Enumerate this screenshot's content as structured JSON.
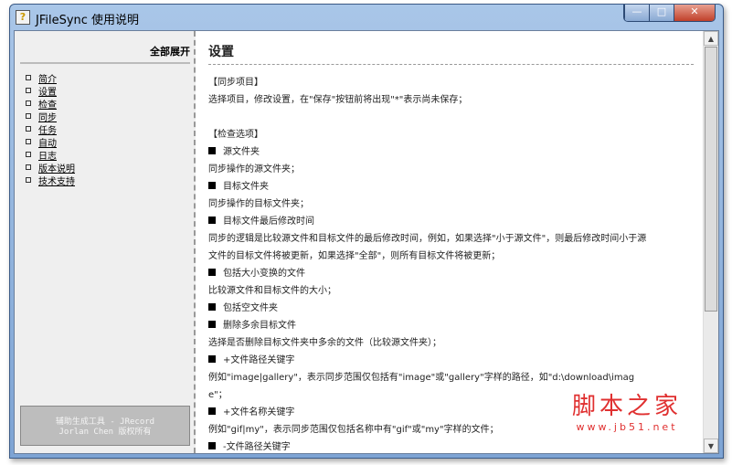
{
  "window": {
    "title": "JFileSync 使用说明",
    "min": "—",
    "max": "□",
    "close": "✕"
  },
  "sidebar": {
    "expand_all": "全部展开",
    "items": [
      "简介",
      "设置",
      "检查",
      "同步",
      "任务",
      "自动",
      "日志",
      "版本说明",
      "技术支持"
    ],
    "footer_line1": "辅助生成工具 - JRecord",
    "footer_line2": "Jorlan Chen 版权所有"
  },
  "content": {
    "title": "设置",
    "lines": [
      {
        "bullet": false,
        "text": "【同步项目】"
      },
      {
        "bullet": false,
        "text": "选择项目，修改设置，在\"保存\"按钮前将出现\"*\"表示尚未保存；"
      },
      {
        "bullet": false,
        "text": ""
      },
      {
        "bullet": false,
        "text": "【检查选项】"
      },
      {
        "bullet": true,
        "text": "源文件夹"
      },
      {
        "bullet": false,
        "text": "同步操作的源文件夹；"
      },
      {
        "bullet": true,
        "text": "目标文件夹"
      },
      {
        "bullet": false,
        "text": "同步操作的目标文件夹；"
      },
      {
        "bullet": true,
        "text": "目标文件最后修改时间"
      },
      {
        "bullet": false,
        "text": "同步的逻辑是比较源文件和目标文件的最后修改时间，例如，如果选择\"小于源文件\"，则最后修改时间小于源"
      },
      {
        "bullet": false,
        "text": "文件的目标文件将被更新，如果选择\"全部\"，则所有目标文件将被更新；"
      },
      {
        "bullet": true,
        "text": "包括大小变换的文件"
      },
      {
        "bullet": false,
        "text": "比较源文件和目标文件的大小；"
      },
      {
        "bullet": true,
        "text": "包括空文件夹"
      },
      {
        "bullet": true,
        "text": "删除多余目标文件"
      },
      {
        "bullet": false,
        "text": "选择是否删除目标文件夹中多余的文件（比较源文件夹）；"
      },
      {
        "bullet": true,
        "text": "+文件路径关键字"
      },
      {
        "bullet": false,
        "text": "例如\"image|gallery\"，表示同步范围仅包括有\"image\"或\"gallery\"字样的路径，如\"d:\\download\\imag"
      },
      {
        "bullet": false,
        "text": "e\"；"
      },
      {
        "bullet": true,
        "text": "+文件名称关键字"
      },
      {
        "bullet": false,
        "text": "例如\"gif|my\"，表示同步范围仅包括名称中有\"gif\"或\"my\"字样的文件；"
      },
      {
        "bullet": true,
        "text": "-文件路径关键字"
      }
    ]
  },
  "watermark": {
    "name": "脚本之家",
    "url": "www.jb51.net"
  }
}
